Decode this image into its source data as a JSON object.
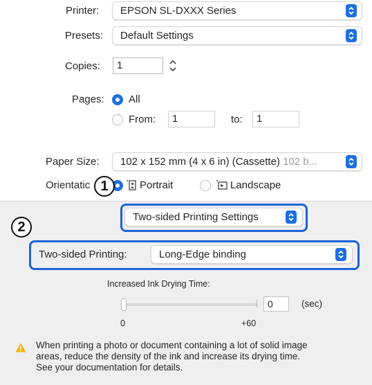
{
  "printer": {
    "label": "Printer:",
    "value": "EPSON SL-DXXX Series"
  },
  "presets": {
    "label": "Presets:",
    "value": "Default Settings"
  },
  "copies": {
    "label": "Copies:",
    "value": "1"
  },
  "pages": {
    "label": "Pages:",
    "all_label": "All",
    "from_label": "From:",
    "from_value": "1",
    "to_label": "to:",
    "to_value": "1"
  },
  "paper_size": {
    "label": "Paper Size:",
    "value": "102 x 152 mm (4 x 6 in) (Cassette)",
    "value_muted": "102 b..."
  },
  "orientation": {
    "label": "Orientatic",
    "portrait": "Portrait",
    "landscape": "Landscape"
  },
  "panel_menu": {
    "value": "Two-sided Printing Settings"
  },
  "two_sided": {
    "label": "Two-sided Printing:",
    "value": "Long-Edge binding"
  },
  "drying": {
    "title": "Increased Ink Drying Time:",
    "value": "0",
    "unit": "(sec)",
    "min_label": "0",
    "max_label": "+60",
    "level_fraction": 0
  },
  "warning": {
    "line1": "When printing a photo or document containing a lot of solid image",
    "line2": "areas, reduce the density of the ink and increase its drying time.",
    "line3": "See your documentation for details."
  },
  "callouts": {
    "one": "1",
    "two": "2"
  },
  "colors": {
    "accent": "#1d6fe0",
    "highlight": "#1c63d6",
    "warning": "#f2b400"
  }
}
